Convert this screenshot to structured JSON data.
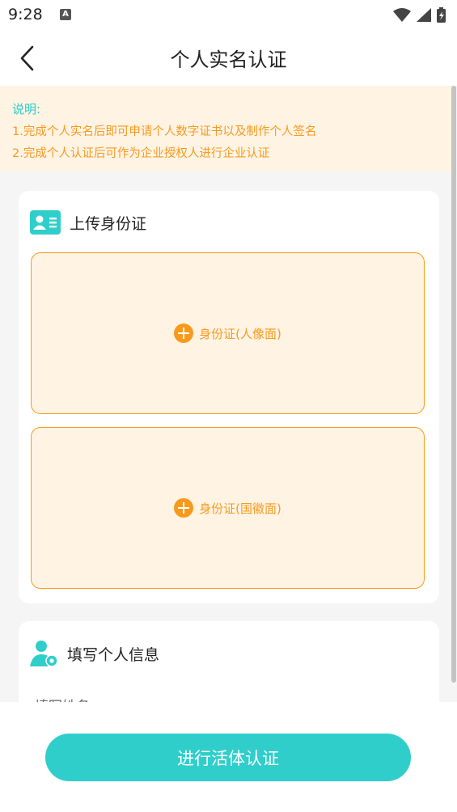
{
  "status_bar": {
    "time": "9:28",
    "notification_icon": "font-a-icon",
    "icons": [
      "wifi-icon",
      "cell-signal-icon",
      "battery-charging-icon"
    ]
  },
  "header": {
    "title": "个人实名认证",
    "back_icon": "chevron-left-icon"
  },
  "notice": {
    "title": "说明:",
    "lines": [
      "1.完成个人实名后即可申请个人数字证书以及制作个人签名",
      "2.完成个人认证后可作为企业授权人进行企业认证"
    ]
  },
  "upload_section": {
    "title": "上传身份证",
    "icon": "id-card-icon",
    "front_label": "身份证(人像面)",
    "back_label": "身份证(国徽面)"
  },
  "info_section": {
    "title": "填写个人信息",
    "icon": "user-settings-icon",
    "partial_field": "填写姓名"
  },
  "action_button": {
    "label": "进行活体认证"
  },
  "colors": {
    "accent_teal": "#2fcecb",
    "accent_orange": "#f79a1c",
    "notice_bg": "#fff3e4"
  }
}
